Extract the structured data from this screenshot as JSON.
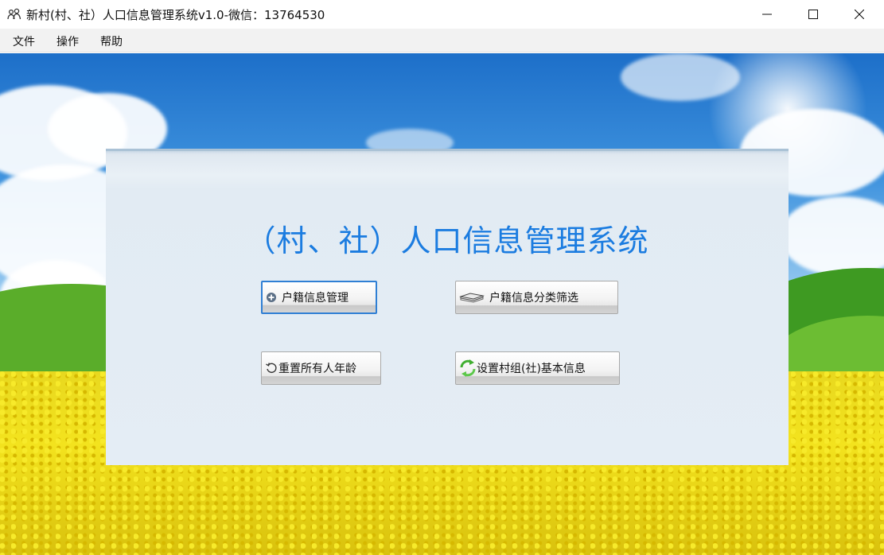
{
  "window": {
    "title": "新村(村、社）人口信息管理系统v1.0-微信：13764530",
    "icon": "people-icon",
    "controls": {
      "minimize": "minimize-icon",
      "maximize": "maximize-icon",
      "close": "close-icon"
    }
  },
  "menu": {
    "items": [
      {
        "label": "文件"
      },
      {
        "label": "操作"
      },
      {
        "label": "帮助"
      }
    ]
  },
  "main": {
    "title": "（村、社）人口信息管理系统",
    "title_color": "#1b7ce0",
    "buttons": {
      "household": {
        "label": "户籍信息管理",
        "icon": "plus-circle-icon",
        "focused": true
      },
      "filter": {
        "label": "户籍信息分类筛选",
        "icon": "stack-icon"
      },
      "reset_age": {
        "label": "重置所有人年龄",
        "icon": "refresh-icon"
      },
      "settings": {
        "label": "设置村组(社)基本信息",
        "icon": "sync-arrows-icon"
      }
    },
    "focus_color": "#2f7fd4"
  }
}
